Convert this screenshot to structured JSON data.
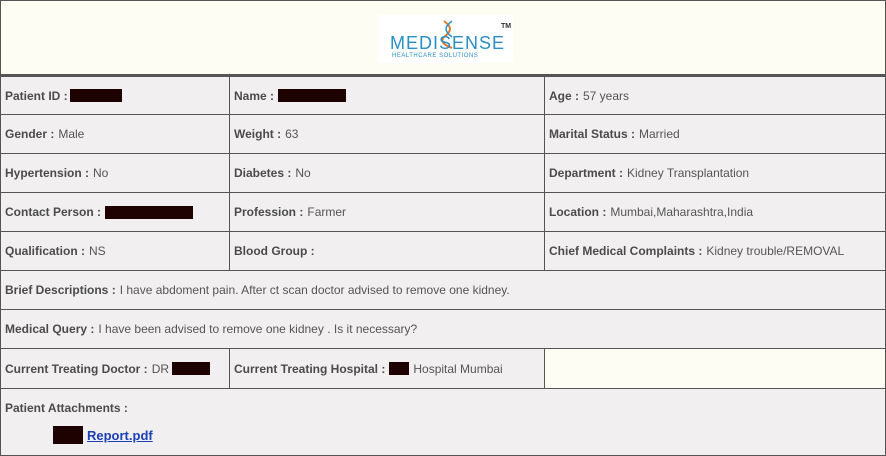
{
  "logo": {
    "brand": "MEDISENSE",
    "tagline": "HEALTHCARE SOLUTIONS",
    "tm": "TM"
  },
  "rows": [
    [
      {
        "label": "Patient ID :",
        "value": "",
        "redacted": true
      },
      {
        "label": "Name :",
        "value": "",
        "redacted": true
      },
      {
        "label": "Age :",
        "value": "57 years"
      }
    ],
    [
      {
        "label": "Gender :",
        "value": "Male"
      },
      {
        "label": "Weight :",
        "value": "63"
      },
      {
        "label": "Marital Status :",
        "value": "Married"
      }
    ],
    [
      {
        "label": "Hypertension :",
        "value": "No"
      },
      {
        "label": "Diabetes :",
        "value": "No"
      },
      {
        "label": "Department :",
        "value": "Kidney Transplantation"
      }
    ],
    [
      {
        "label": "Contact Person :",
        "value": "",
        "redacted": true
      },
      {
        "label": "Profession :",
        "value": "Farmer"
      },
      {
        "label": "Location :",
        "value": "Mumbai,Maharashtra,India"
      }
    ],
    [
      {
        "label": "Qualification :",
        "value": "NS"
      },
      {
        "label": "Blood Group :",
        "value": ""
      },
      {
        "label": "Chief Medical Complaints :",
        "value": "Kidney trouble/REMOVAL"
      }
    ]
  ],
  "brief": {
    "label": "Brief Descriptions :",
    "value": "I have abdoment pain. After ct scan doctor advised to remove one kidney."
  },
  "query": {
    "label": "Medical Query :",
    "value": "I have been advised to remove one kidney . Is it necessary?"
  },
  "treating": {
    "doctor_label": "Current Treating Doctor :",
    "doctor_value": "DR",
    "hospital_label": "Current Treating Hospital :",
    "hospital_value": "Hospital Mumbai"
  },
  "attachments": {
    "label": "Patient Attachments :",
    "file": "Report.pdf"
  }
}
